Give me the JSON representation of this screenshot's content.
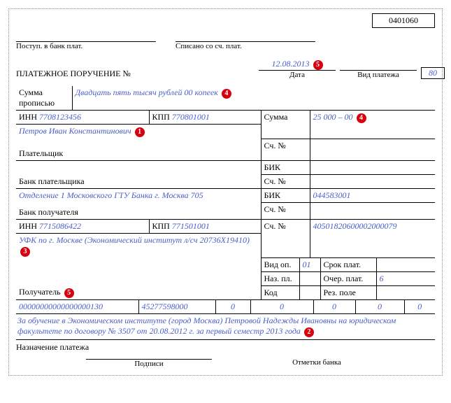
{
  "code_top": "0401060",
  "header": {
    "bank_in_label": "Поступ. в банк плат.",
    "written_off_label": "Списано со сч. плат.",
    "title": "ПЛАТЕЖНОЕ ПОРУЧЕНИЕ №",
    "date_value": "12.08.2013",
    "date_label": "Дата",
    "payment_type_label": "Вид платежа",
    "payment_type_value": "80"
  },
  "amount_words": {
    "label1": "Сумма",
    "label2": "прописью",
    "value": "Двадцать пять тысяч рублей 00 копеек"
  },
  "payer": {
    "inn_label": "ИНН",
    "inn": "7708123456",
    "kpp_label": "КПП",
    "kpp": "770801001",
    "sum_label": "Сумма",
    "sum_value": "25 000 – 00",
    "name": "Петров Иван Константинович",
    "label": "Плательщик",
    "acct_label": "Сч. №",
    "bik_label": "БИК",
    "bank_label": "Банк плательщика"
  },
  "payee_bank": {
    "name": "Отделение 1 Московского ГТУ Банка г. Москва 705",
    "label": "Банк получателя",
    "bik_label": "БИК",
    "bik": "044583001",
    "acct_label": "Сч. №"
  },
  "payee": {
    "inn_label": "ИНН",
    "inn": "7715086422",
    "kpp_label": "КПП",
    "kpp": "771501001",
    "acct_label": "Сч. №",
    "acct": "40501820600002000079",
    "name": "УФК по г. Москве (Экономический институт л/сч 20736Х19410)",
    "label": "Получатель",
    "vid_op_label": "Вид оп.",
    "vid_op": "01",
    "srok_label": "Срок плат.",
    "naz_label": "Наз. пл.",
    "ocher_label": "Очер. плат.",
    "ocher": "6",
    "kod_label": "Код",
    "rez_label": "Рез. поле"
  },
  "bottom_row": {
    "c1": "00000000000000000130",
    "c2": "45277598000",
    "c3": "0",
    "c4": "0",
    "c5": "0",
    "c6": "0",
    "c7": "0"
  },
  "purpose": {
    "text": "За обучение в Экономическом институте (город Москва) Петровой Надежды Ивановны на юридическом факультете по договору № 3507 от 20.08.2012 г. за первый семестр 2013 года",
    "label": "Назначение платежа"
  },
  "footer": {
    "sign_label": "Подписи",
    "bank_mark_label": "Отметки банка"
  },
  "badges": {
    "b1": "1",
    "b2": "2",
    "b3": "3",
    "b4": "4",
    "b5": "5"
  }
}
